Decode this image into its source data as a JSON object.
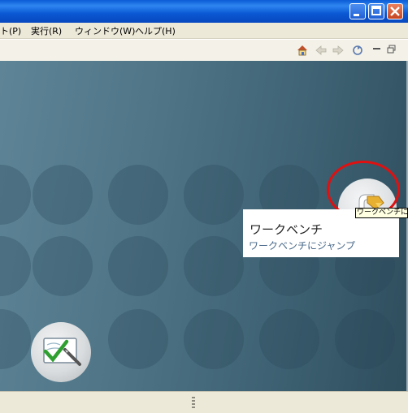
{
  "menu": {
    "items": [
      {
        "label": "ト(P)"
      },
      {
        "label": "実行(R)"
      },
      {
        "label": "ウィンドウ(W)"
      },
      {
        "label": "ヘルプ(H)"
      }
    ]
  },
  "workbench": {
    "tooltip": "ワークベンチに",
    "title": "ワークベンチ",
    "description": "ワークベンチにジャンプ"
  },
  "icons": {
    "home": "home-icon",
    "back": "back-arrow-icon",
    "forward": "forward-arrow-icon",
    "sync": "sync-icon",
    "minimize": "minimize-view-icon",
    "maximize": "maximize-view-icon",
    "workbench": "workbench-icon",
    "tutorial": "tutorials-icon"
  },
  "colors": {
    "titlebar": "#0a5bd6",
    "welcome_background": "#4f7587",
    "highlight_ring": "#e01010",
    "tooltip_bg": "#ffffe1"
  }
}
